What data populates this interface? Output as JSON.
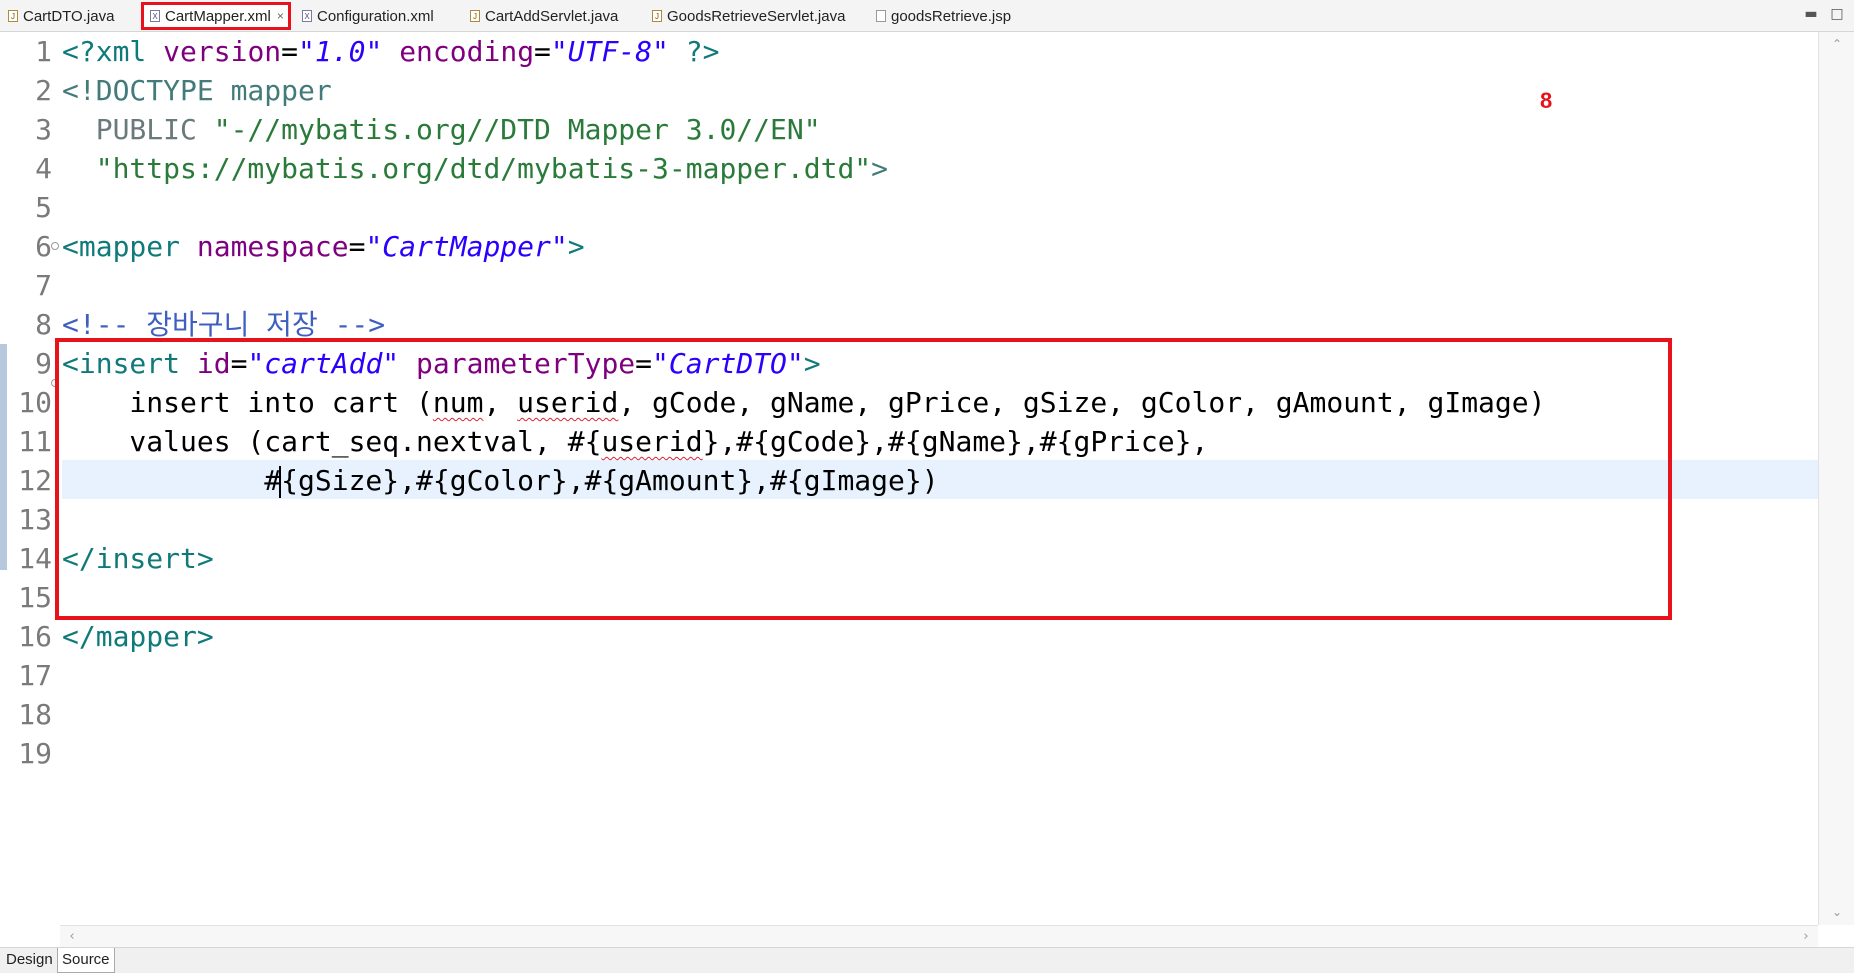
{
  "tabs": [
    {
      "label": "CartDTO.java",
      "icon": "java-file-icon"
    },
    {
      "label": "CartMapper.xml",
      "icon": "xml-file-icon",
      "active": true
    },
    {
      "label": "Configuration.xml",
      "icon": "xml-file-icon"
    },
    {
      "label": "CartAddServlet.java",
      "icon": "java-file-icon"
    },
    {
      "label": "GoodsRetrieveServlet.java",
      "icon": "java-file-icon"
    },
    {
      "label": "goodsRetrieve.jsp",
      "icon": "jsp-file-icon"
    }
  ],
  "tab_close_glyph": "×",
  "annotation": "8",
  "line_numbers": [
    "1",
    "2",
    "3",
    "4",
    "5",
    "6",
    "7",
    "8",
    "9",
    "10",
    "11",
    "12",
    "13",
    "14",
    "15",
    "16",
    "17",
    "18",
    "19"
  ],
  "code": {
    "l1": {
      "a": "<?xml ",
      "b": "version",
      "c": "=",
      "d": "\"1.0\"",
      "e": " ",
      "f": "encoding",
      "g": "=",
      "h": "\"UTF-8\"",
      "i": " ?>"
    },
    "l2": {
      "a": "<!DOCTYPE mapper"
    },
    "l3": {
      "a": "  PUBLIC ",
      "b": "\"-//mybatis.org//DTD Mapper 3.0//EN\""
    },
    "l4": {
      "a": "  ",
      "b": "\"https://mybatis.org/dtd/mybatis-3-mapper.dtd\"",
      "c": ">"
    },
    "l6": {
      "a": "<mapper ",
      "b": "namespace",
      "c": "=",
      "d": "\"CartMapper\"",
      "e": ">"
    },
    "l8": {
      "a": "<!-- 장바구니 저장 -->"
    },
    "l9": {
      "a": "<insert ",
      "b": "id",
      "c": "=",
      "d": "\"cartAdd\"",
      "e": " ",
      "f": "parameterType",
      "g": "=",
      "h": "\"CartDTO\"",
      "i": ">"
    },
    "l10": {
      "a": "    insert into cart (",
      "b": "num",
      "c": ", ",
      "d": "userid",
      "e": ", gCode, gName, gPrice, gSize, gColor, gAmount, gImage)"
    },
    "l11": {
      "a": "    values (cart_seq.nextval, #{",
      "b": "userid",
      "c": "},#{gCode},#{gName},#{gPrice},"
    },
    "l12": {
      "a": "            #{gSize},#{gColor},#{gAmount},#{gImage})"
    },
    "l14": {
      "a": "</insert>"
    },
    "l16": {
      "a": "</mapper>"
    }
  },
  "bottom_tabs": {
    "design": "Design",
    "source": "Source"
  }
}
